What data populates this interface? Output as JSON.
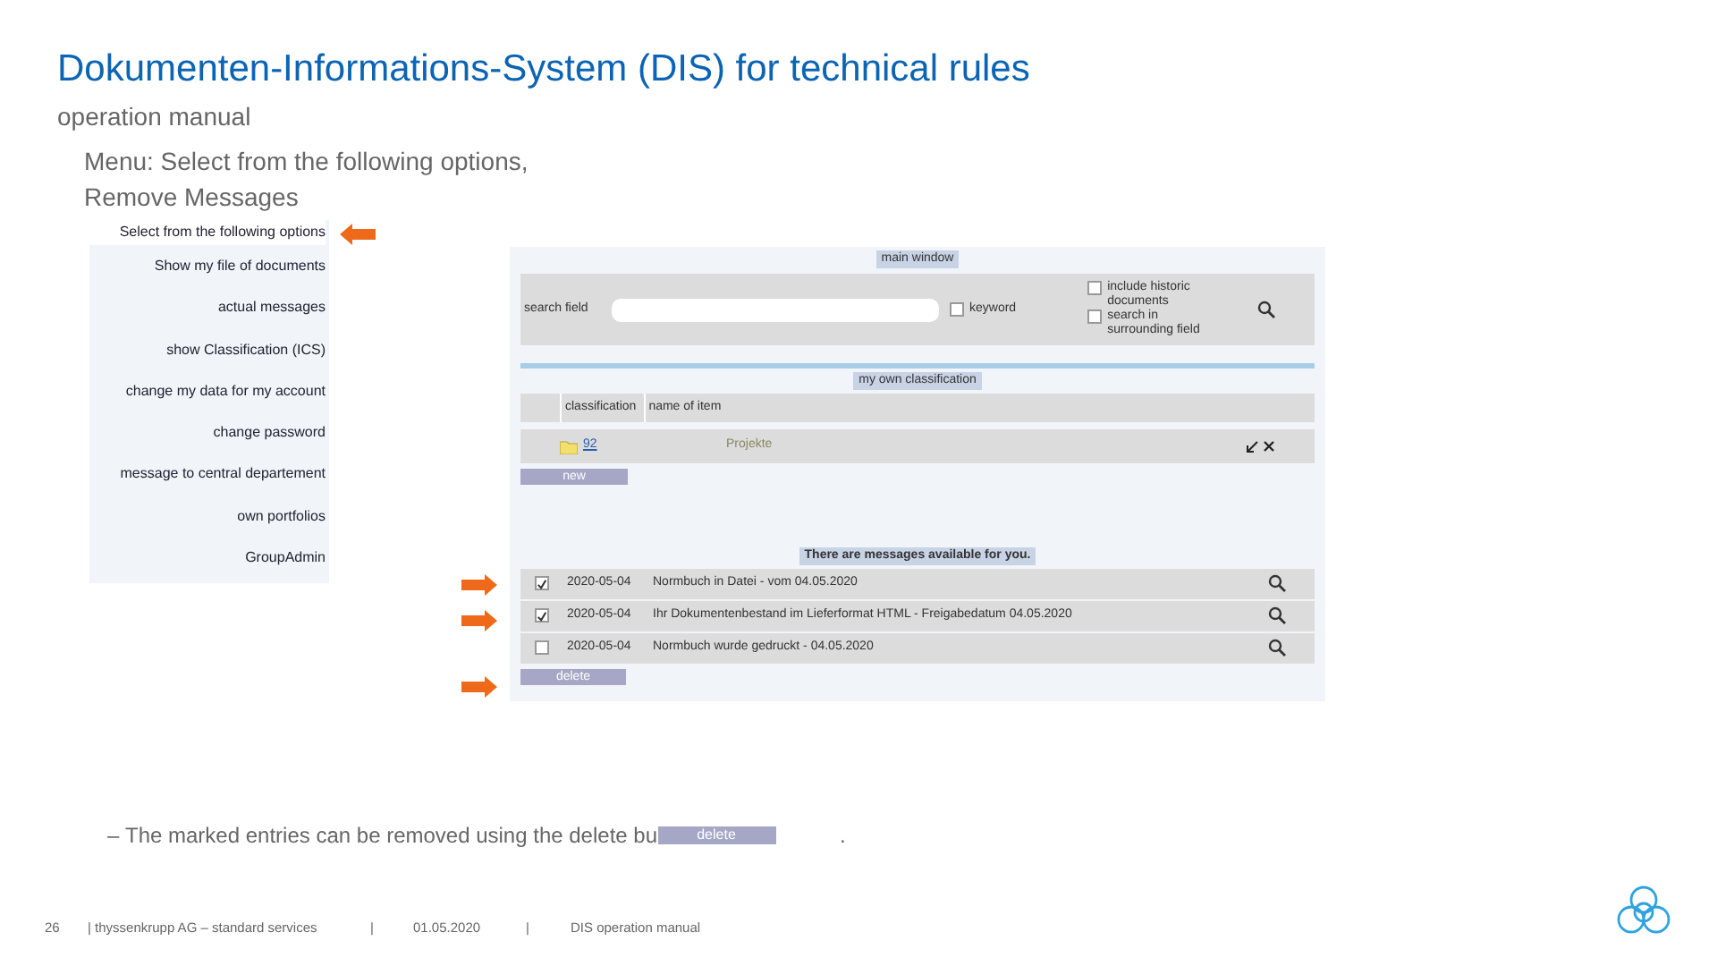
{
  "title": "Dokumenten-Informations-System (DIS) for technical rules",
  "subtitle": "operation manual",
  "intro": [
    "Menu: Select from the following options,",
    "Remove Messages"
  ],
  "menu": {
    "heading": "Select from the following options",
    "items": [
      "Show my file of documents",
      "actual messages",
      "show Classification (ICS)",
      "change my data for my account",
      "change password",
      "message to central departement",
      "own portfolios",
      "GroupAdmin"
    ]
  },
  "main_window": {
    "title": "main window",
    "search_label": "search field",
    "keyword": {
      "label": "keyword",
      "checked": false
    },
    "options": [
      {
        "label": "include historic documents",
        "checked": false
      },
      {
        "label": "search in surrounding field",
        "checked": false
      }
    ],
    "classification_title": "my own classification",
    "columns": [
      "classification",
      "name of item"
    ],
    "items": [
      {
        "classification": "92",
        "name": "Projekte"
      }
    ],
    "new_button": "new",
    "messages_title": "There are messages available for you.",
    "messages": [
      {
        "checked": true,
        "date": "2020-05-04",
        "text": "Normbuch in Datei - vom 04.05.2020"
      },
      {
        "checked": true,
        "date": "2020-05-04",
        "text": "Ihr Dokumentenbestand im Lieferformat HTML - Freigabedatum 04.05.2020"
      },
      {
        "checked": false,
        "date": "2020-05-04",
        "text": "Normbuch wurde gedruckt - 04.05.2020"
      }
    ],
    "delete_button": "delete"
  },
  "bullet": {
    "marker": "–",
    "text": "The marked entries can be removed using the delete bu",
    "button": "delete",
    "end": "."
  },
  "footer": {
    "page": "26",
    "company": "| thyssenkrupp AG – standard services",
    "sep1": "|",
    "date": "01.05.2020",
    "sep2": "|",
    "doc": "DIS operation manual"
  }
}
